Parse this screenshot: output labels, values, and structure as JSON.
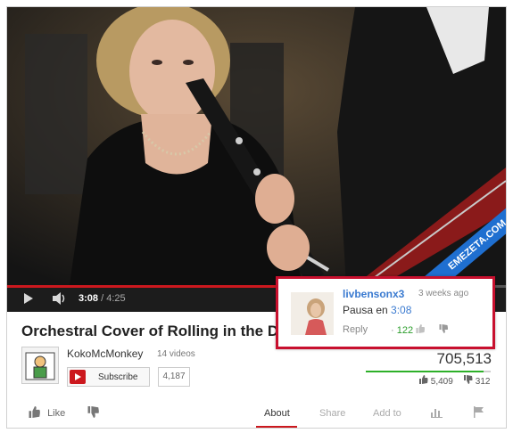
{
  "player": {
    "current_time": "3:08",
    "separator": " / ",
    "duration": "4:25",
    "progress": 0.71,
    "watermark": "EMEZETA.COM"
  },
  "video": {
    "title": "Orchestral Cover of Rolling in the D",
    "channel_name": "KokoMcMonkey",
    "video_count": "14 videos",
    "subscribe_label": "Subscribe",
    "subscriber_count": "4,187",
    "views": "705,513",
    "likes": "5,409",
    "dislikes": "312",
    "like_ratio": 0.945
  },
  "actions": {
    "like": "Like",
    "about": "About",
    "share": "Share",
    "add_to": "Add to"
  },
  "comment": {
    "username": "livbensonx3",
    "time": "3 weeks ago",
    "text": "Pausa en ",
    "timestamp_link": "3:08",
    "reply": "Reply",
    "likes": "122"
  },
  "colors": {
    "accent_red": "#cc181e",
    "link_blue": "#3a7ad0",
    "like_green": "#2db029",
    "highlight_border": "#c8102e"
  }
}
